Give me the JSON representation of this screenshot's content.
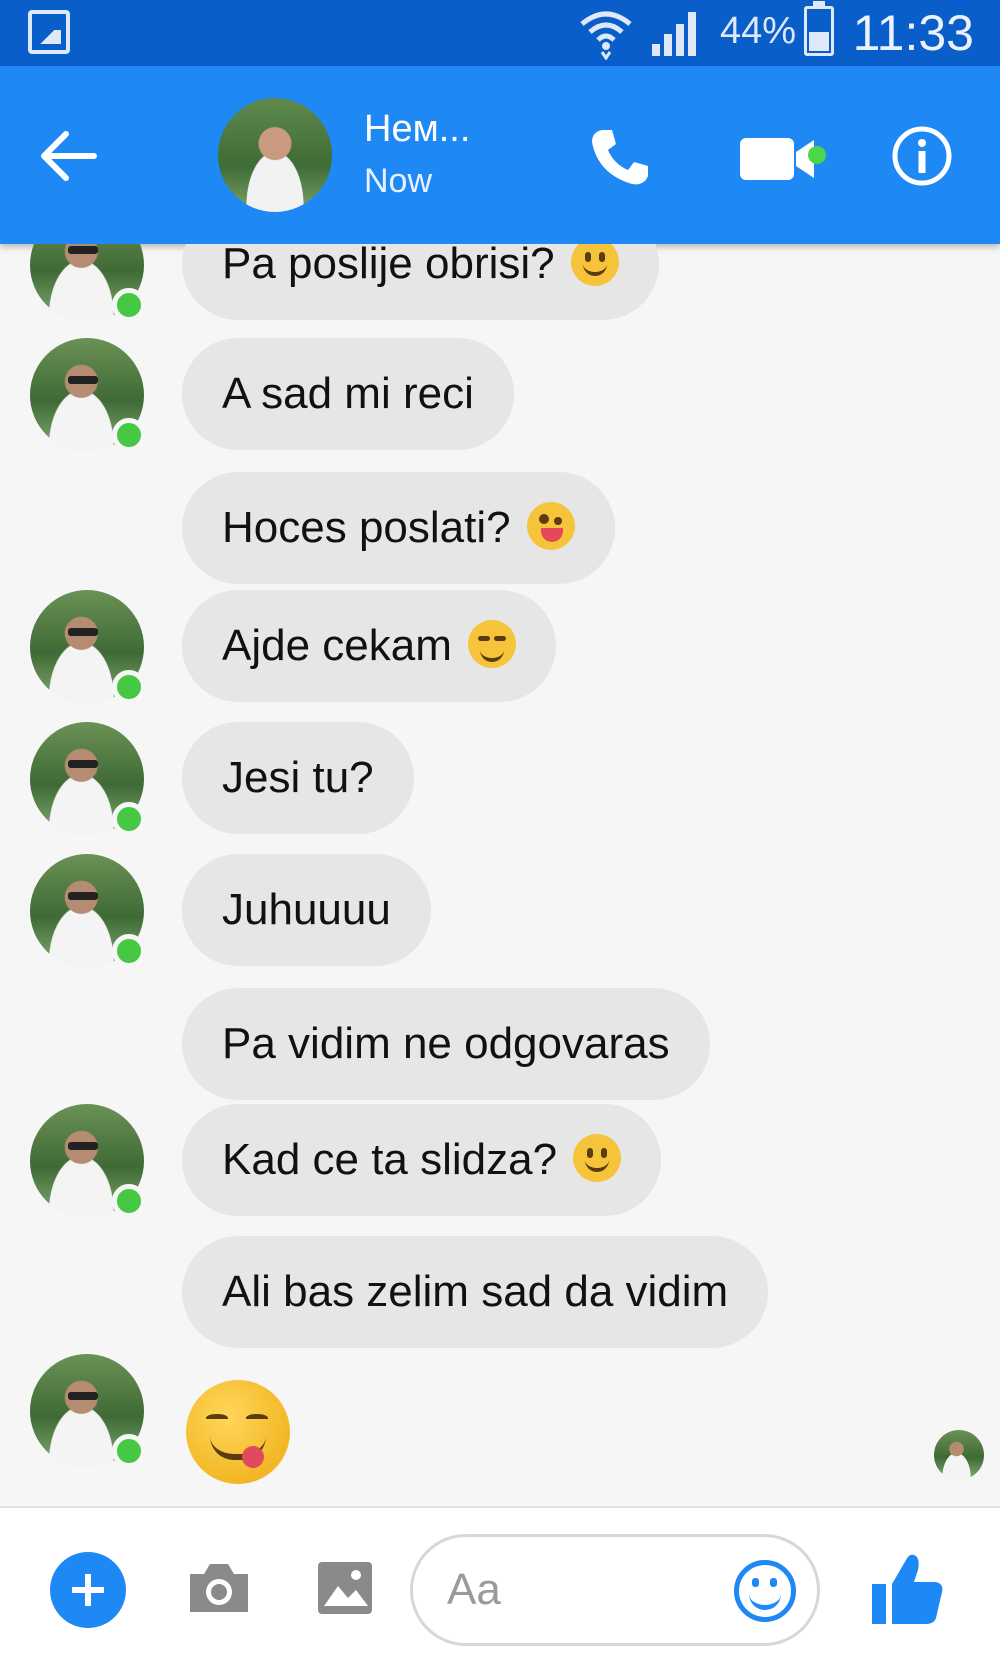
{
  "status_bar": {
    "battery": "44%",
    "battery_level": 0.44,
    "time": "11:33"
  },
  "header": {
    "contact_name": "Нем...",
    "contact_status": "Now"
  },
  "messages": [
    {
      "text": "Pa poslije obrisi?",
      "emoji": "smile",
      "avatar": true
    },
    {
      "text": "A sad mi reci",
      "emoji": "",
      "avatar": true
    },
    {
      "text": "Hoces poslati?",
      "emoji": "wink-tongue",
      "avatar": false
    },
    {
      "text": "Ajde cekam",
      "emoji": "yum",
      "avatar": true
    },
    {
      "text": "Jesi tu?",
      "emoji": "",
      "avatar": true
    },
    {
      "text": "Juhuuuu",
      "emoji": "",
      "avatar": true
    },
    {
      "text": "Pa vidim ne odgovaras",
      "emoji": "",
      "avatar": false
    },
    {
      "text": "Kad ce ta slidza?",
      "emoji": "smile",
      "avatar": true
    },
    {
      "text": "Ali bas zelim sad da vidim",
      "emoji": "",
      "avatar": false
    },
    {
      "text": "",
      "emoji": "yum-large",
      "avatar": true
    }
  ],
  "composer": {
    "placeholder": "Aa"
  },
  "colors": {
    "status_bar": "#0a5ec9",
    "header": "#1e88f5",
    "bubble": "#e6e6e6",
    "online": "#46c843"
  }
}
